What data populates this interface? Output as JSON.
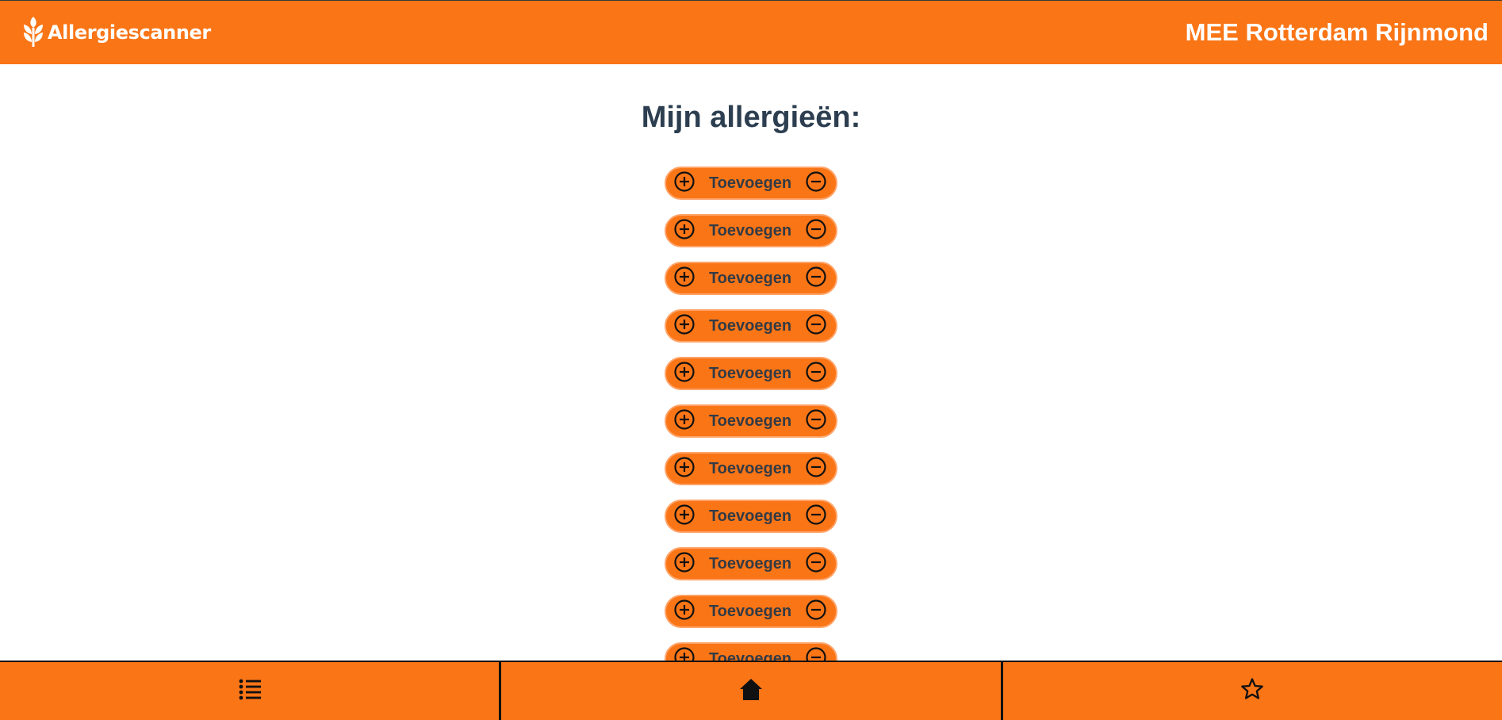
{
  "header": {
    "brand_name": "Allergiescanner",
    "org_title": "MEE Rotterdam Rijnmond",
    "brand_color": "#fa7516",
    "logo_icon": "wheat-icon"
  },
  "main": {
    "title": "Mijn allergieën:",
    "items": [
      {
        "label": "Toevoegen"
      },
      {
        "label": "Toevoegen"
      },
      {
        "label": "Toevoegen"
      },
      {
        "label": "Toevoegen"
      },
      {
        "label": "Toevoegen"
      },
      {
        "label": "Toevoegen"
      },
      {
        "label": "Toevoegen"
      },
      {
        "label": "Toevoegen"
      },
      {
        "label": "Toevoegen"
      },
      {
        "label": "Toevoegen"
      },
      {
        "label": "Toevoegen"
      }
    ],
    "item_icons": {
      "add": "plus-circle-icon",
      "remove": "minus-circle-icon"
    }
  },
  "bottom_nav": {
    "items": [
      {
        "icon": "list-icon"
      },
      {
        "icon": "home-icon"
      },
      {
        "icon": "star-icon"
      }
    ]
  }
}
